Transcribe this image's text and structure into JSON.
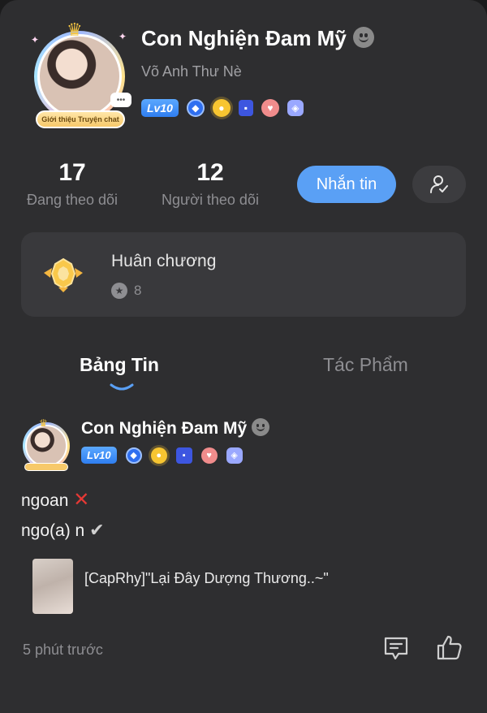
{
  "profile": {
    "display_name": "Con Nghiện Đam Mỹ",
    "username": "Võ Anh Thư Nè",
    "level": "Lv10",
    "avatar_tag": "Giới thiệu Truyện chat",
    "avatar_chat_bubble": "•••"
  },
  "stats": {
    "following_count": "17",
    "following_label": "Đang theo dõi",
    "followers_count": "12",
    "followers_label": "Người theo dõi"
  },
  "actions": {
    "message_label": "Nhắn tin"
  },
  "medals": {
    "title": "Huân chương",
    "count": "8"
  },
  "tabs": [
    {
      "label": "Bảng Tin",
      "active": true
    },
    {
      "label": "Tác Phẩm",
      "active": false
    }
  ],
  "post": {
    "author": "Con Nghiện Đam Mỹ",
    "level": "Lv10",
    "line1": "ngoan",
    "line2": "ngo(a) n",
    "story_title": "[CapRhy]\"Lại Đây Dượng Thương..~\"",
    "time": "5 phút trước"
  },
  "colors": {
    "background": "#2e2e30",
    "card": "#39393c",
    "accent": "#5aa0f5",
    "muted_text": "#8e8e92"
  }
}
